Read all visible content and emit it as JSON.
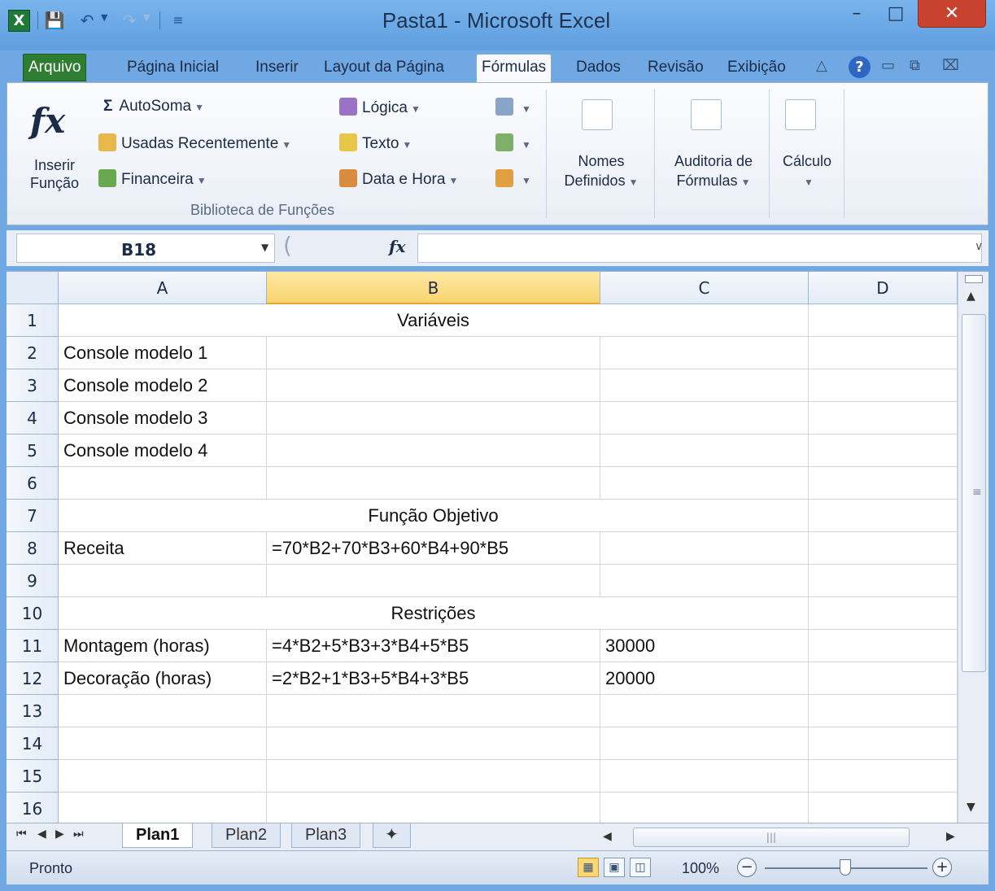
{
  "window": {
    "title": "Pasta1 - Microsoft Excel"
  },
  "title_controls": {
    "minimize": "–",
    "maximize": "□",
    "close": "✕"
  },
  "ribbon_tabs": [
    "Arquivo",
    "Página Inicial",
    "Inserir",
    "Layout da Página",
    "Fórmulas",
    "Dados",
    "Revisão",
    "Exibição"
  ],
  "active_tab": "Fórmulas",
  "ribbon": {
    "insert_function": {
      "line1": "Inserir",
      "line2": "Função"
    },
    "autosum": "AutoSoma",
    "recent": "Usadas Recentemente",
    "financial": "Financeira",
    "logical": "Lógica",
    "text": "Texto",
    "datetime": "Data e Hora",
    "group_label": "Biblioteca de Funções",
    "names": {
      "line1": "Nomes",
      "line2": "Definidos"
    },
    "auditing": {
      "line1": "Auditoria de",
      "line2": "Fórmulas"
    },
    "calculation": "Cálculo"
  },
  "formula_bar": {
    "name_box": "B18",
    "fx_label": "fx",
    "value": ""
  },
  "columns": [
    "A",
    "B",
    "C",
    "D"
  ],
  "selected_column": "B",
  "rows": [
    "1",
    "2",
    "3",
    "4",
    "5",
    "6",
    "7",
    "8",
    "9",
    "10",
    "11",
    "12",
    "13",
    "14",
    "15",
    "16"
  ],
  "cells": {
    "r1_merged": "Variáveis",
    "A2": "Console modelo 1",
    "A3": "Console modelo 2",
    "A4": "Console modelo 3",
    "A5": "Console modelo 4",
    "r7_merged": "Função Objetivo",
    "A8": "Receita",
    "B8": "=70*B2+70*B3+60*B4+90*B5",
    "r10_merged": "Restrições",
    "A11": "Montagem (horas)",
    "B11": "=4*B2+5*B3+3*B4+5*B5",
    "C11": "30000",
    "A12": "Decoração (horas)",
    "B12": "=2*B2+1*B3+5*B4+3*B5",
    "C12": "20000"
  },
  "sheet_tabs": [
    "Plan1",
    "Plan2",
    "Plan3"
  ],
  "active_sheet": "Plan1",
  "status": {
    "text": "Pronto",
    "zoom": "100%"
  },
  "colors": {
    "title_bar": "#6fa8e3",
    "file_tab": "#2e7d32",
    "selected_header": "#f9d46e",
    "close_button": "#c9412f"
  }
}
